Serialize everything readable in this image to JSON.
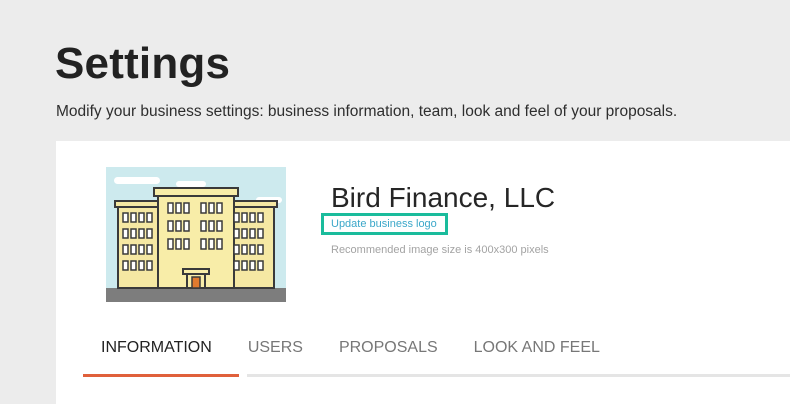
{
  "page": {
    "title": "Settings",
    "subtitle": "Modify your business settings: business information, team, look and feel of your proposals."
  },
  "business": {
    "name": "Bird Finance, LLC",
    "update_logo_label": "Update business logo",
    "logo_hint": "Recommended image size is 400x300 pixels",
    "logo_icon": "office-building-icon"
  },
  "tabs": [
    {
      "label": "INFORMATION",
      "active": true
    },
    {
      "label": "USERS",
      "active": false
    },
    {
      "label": "PROPOSALS",
      "active": false
    },
    {
      "label": "LOOK AND FEEL",
      "active": false
    }
  ],
  "colors": {
    "active_tab_underline": "#e0603b",
    "highlight_box": "#1abc9c",
    "link": "#3ba7c9"
  }
}
